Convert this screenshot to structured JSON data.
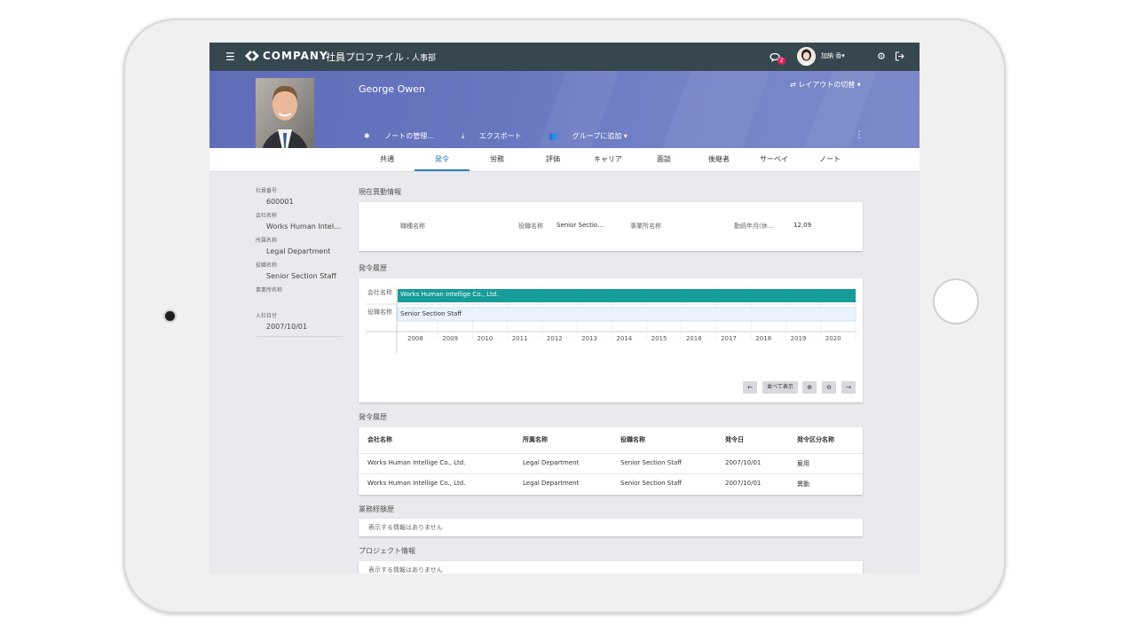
{
  "app": {
    "brand": "COMPANY",
    "title": "社員プロファイル",
    "department": " - 人事部",
    "notification_count": "2",
    "user_name": "加納 香▾"
  },
  "profile": {
    "name": "George Owen",
    "layout_switch": "⇄ レイアウトの切替 ▾",
    "actions": [
      "ノートの管理…",
      "エクスポート",
      "グループに追加 ▾"
    ]
  },
  "tabs": [
    "共通",
    "発令",
    "労務",
    "評価",
    "キャリア",
    "面談",
    "後継者",
    "サーベイ",
    "ノート"
  ],
  "active_tab": "発令",
  "sidebar": [
    {
      "label": "社員番号",
      "value": "600001"
    },
    {
      "label": "会社名称",
      "value": "Works Human Intelli…"
    },
    {
      "label": "所属名称",
      "value": "Legal Department"
    },
    {
      "label": "役職名称",
      "value": "Senior Section Staff"
    },
    {
      "label": "事業所名称",
      "value": ""
    },
    {
      "label": "入社日付",
      "value": "2007/10/01"
    }
  ],
  "current": {
    "section_title": "現在異動情報",
    "job_title_label": "職種名称",
    "position_label": "役職名称",
    "position_value": "Senior Sectio…",
    "office_label": "事業所名称",
    "tenure_label": "勤続年月(休…",
    "tenure_value": "12.09"
  },
  "timeline": {
    "section_title": "発令履歴",
    "company_row_label": "会社名称",
    "company_bar_text": "Works Human Intellige Co., Ltd.",
    "position_row_label": "役職名称",
    "position_bar_text": "Senior Section Staff",
    "years": [
      "2008",
      "2009",
      "2010",
      "2011",
      "2012",
      "2013",
      "2014",
      "2015",
      "2016",
      "2017",
      "2018",
      "2019",
      "2020"
    ],
    "controls": {
      "prev": "←",
      "side_by_side": "並べて表示",
      "zoom_in": "⊕",
      "zoom_out": "⊖",
      "next": "→"
    },
    "colors": {
      "company_bar": "#169c99",
      "position_bar": "#eaf2fd"
    }
  },
  "history": {
    "section_title": "発令履歴",
    "columns": [
      "会社名称",
      "所属名称",
      "役職名称",
      "発令日",
      "発令区分名称"
    ],
    "rows": [
      [
        "Works Human Intellige Co., Ltd.",
        "Legal Department",
        "Senior Section Staff",
        "2007/10/01",
        "雇用"
      ],
      [
        "Works Human Intellige Co., Ltd.",
        "Legal Department",
        "Senior Section Staff",
        "2007/10/01",
        "異動"
      ]
    ]
  },
  "work_experience": {
    "section_title": "業務経験歴",
    "empty": "表示する情報はありません"
  },
  "projects": {
    "section_title": "プロジェクト情報",
    "empty": "表示する情報はありません"
  }
}
